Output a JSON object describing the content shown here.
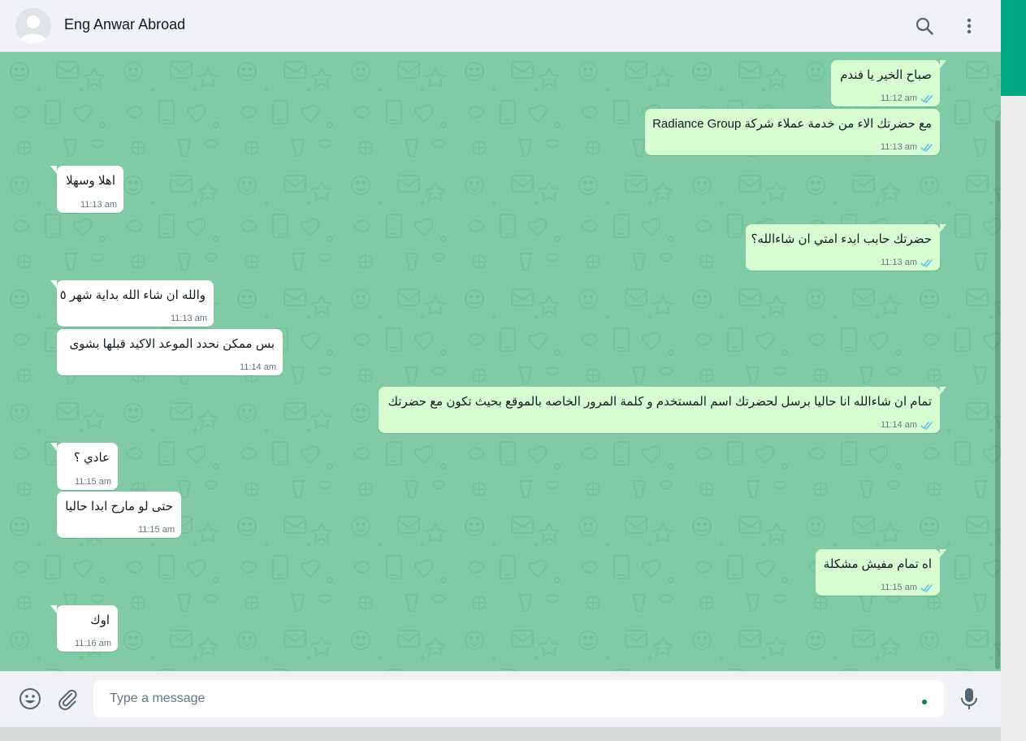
{
  "header": {
    "contact_name": "Eng Anwar Abroad",
    "icons": [
      "default-avatar-icon",
      "search-icon",
      "menu-dots-icon"
    ]
  },
  "messages": [
    {
      "direction": "out",
      "text": "صباح الخير يا فندم",
      "time": "11:12 am",
      "status": "read"
    },
    {
      "direction": "out",
      "text": "مع حضرتك الاء من خدمة عملاء شركة Radiance Group",
      "time": "11:13 am",
      "status": "read"
    },
    {
      "direction": "in",
      "text": "اهلا وسهلا",
      "time": "11:13 am"
    },
    {
      "direction": "out",
      "text": "حضرتك حابب ابدء امتي ان شاءالله؟",
      "time": "11:13 am",
      "status": "read"
    },
    {
      "direction": "in",
      "text": "والله ان شاء الله بداية شهر ٥",
      "time": "11:13 am"
    },
    {
      "direction": "in",
      "text": "بس ممكن نحدد الموعد الاكيد قبلها بشوى",
      "time": "11:14 am"
    },
    {
      "direction": "out",
      "text": "تمام ان شاءالله انا حاليا برسل لحضرتك اسم المستخدم و كلمة المرور الخاصه بالموقع بحيث تكون مع حضرتك",
      "time": "11:14 am",
      "status": "read"
    },
    {
      "direction": "in",
      "text": "عادي ؟",
      "time": "11:15 am"
    },
    {
      "direction": "in",
      "text": "حتى لو مارح ابدا حاليا",
      "time": "11:15 am"
    },
    {
      "direction": "out",
      "text": "اه تمام مفيش مشكلة",
      "time": "11:15 am",
      "status": "read"
    },
    {
      "direction": "in",
      "text": "اوك",
      "time": "11:16 am"
    }
  ],
  "composer": {
    "placeholder": "Type a message",
    "icons": [
      "emoji-icon",
      "attach-icon",
      "mic-icon"
    ]
  },
  "colors": {
    "accent": "#00a884",
    "chat_bg": "#80cba5",
    "outgoing_bubble": "#d9fdd3",
    "incoming_bubble": "#ffffff",
    "read_ticks": "#53bdeb"
  }
}
